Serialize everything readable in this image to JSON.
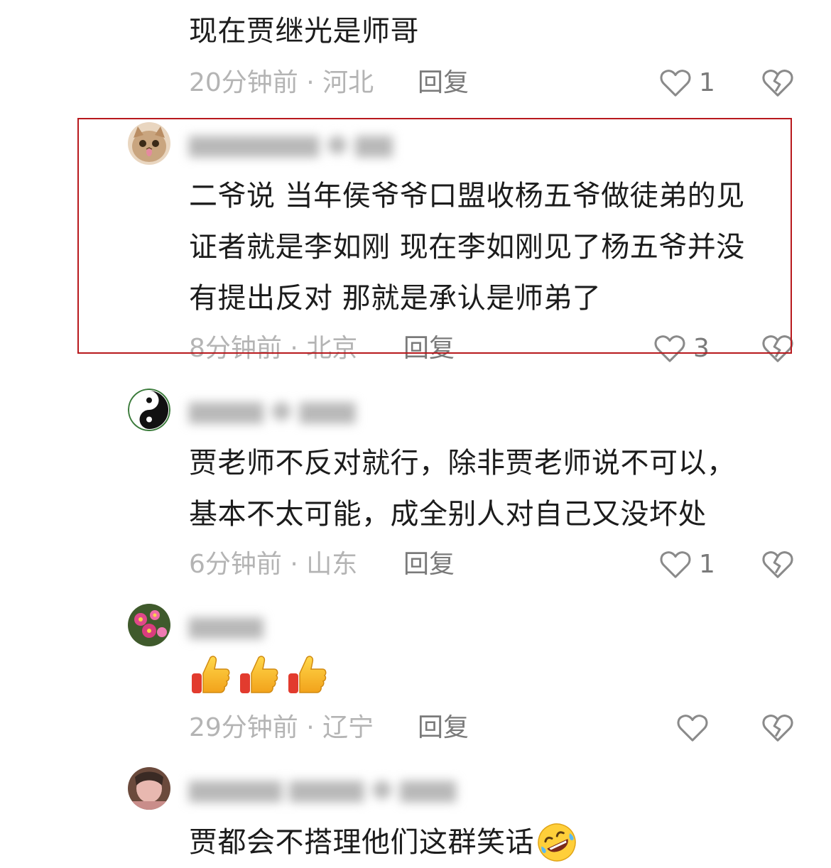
{
  "comments": [
    {
      "text_lines": [
        "现在贾继光是师哥"
      ],
      "time": "20分钟前",
      "location": "河北",
      "reply_label": "回复",
      "likes": "1"
    },
    {
      "text_lines": [
        "二爷说 当年侯爷爷口盟收杨五爷做徒弟的见",
        "证者就是李如刚 现在李如刚见了杨五爷并没",
        "有提出反对 那就是承认是师弟了"
      ],
      "time": "8分钟前",
      "location": "北京",
      "reply_label": "回复",
      "likes": "3",
      "avatar_icon": "cat-avatar-icon",
      "highlighted": true
    },
    {
      "text_lines": [
        "贾老师不反对就行，除非贾老师说不可以，",
        "基本不太可能，成全别人对自己又没坏处"
      ],
      "time": "6分钟前",
      "location": "山东",
      "reply_label": "回复",
      "likes": "1",
      "avatar_icon": "yin-yang-avatar-icon"
    },
    {
      "emojis": [
        "thumbs-up-icon",
        "thumbs-up-icon",
        "thumbs-up-icon"
      ],
      "time": "29分钟前",
      "location": "辽宁",
      "reply_label": "回复",
      "likes": "",
      "avatar_icon": "flowers-avatar-icon"
    },
    {
      "text_lines": [
        "贾都会不搭理他们这群笑话"
      ],
      "trailing_emoji": "rolling-laughing-icon",
      "avatar_icon": "photo-avatar-icon"
    }
  ],
  "separator": "·",
  "colors": {
    "highlight_border": "#b8191d",
    "meta_text": "#b4b4b4",
    "body_text": "#1c1c1c"
  }
}
